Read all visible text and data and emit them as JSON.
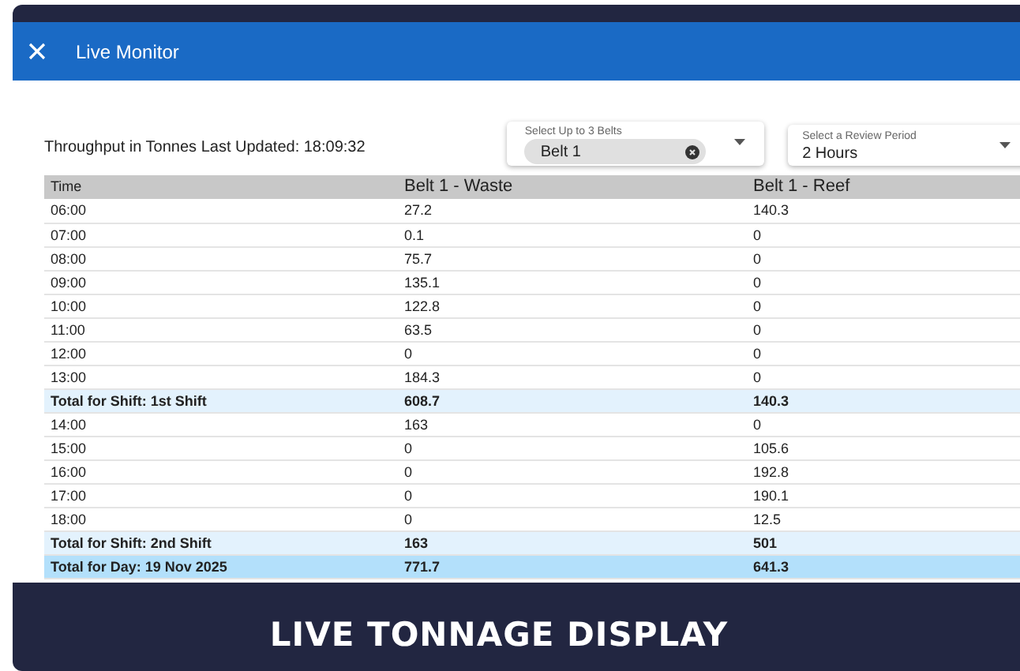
{
  "window": {
    "title": "Live Monitor"
  },
  "summary": "Throughput in Tonnes Last Updated: 18:09:32",
  "belt_select": {
    "label": "Select Up to 3 Belts",
    "chips": [
      "Belt 1"
    ]
  },
  "period_select": {
    "label": "Select a Review Period",
    "value": "2 Hours"
  },
  "table": {
    "columns": [
      "Time",
      "Belt 1 - Waste",
      "Belt 1 - Reef"
    ],
    "rows": [
      {
        "kind": "hour",
        "cells": [
          "06:00",
          "27.2",
          "140.3"
        ]
      },
      {
        "kind": "hour",
        "cells": [
          "07:00",
          "0.1",
          "0"
        ]
      },
      {
        "kind": "hour",
        "cells": [
          "08:00",
          "75.7",
          "0"
        ]
      },
      {
        "kind": "hour",
        "cells": [
          "09:00",
          "135.1",
          "0"
        ]
      },
      {
        "kind": "hour",
        "cells": [
          "10:00",
          "122.8",
          "0"
        ]
      },
      {
        "kind": "hour",
        "cells": [
          "11:00",
          "63.5",
          "0"
        ]
      },
      {
        "kind": "hour",
        "cells": [
          "12:00",
          "0",
          "0"
        ]
      },
      {
        "kind": "hour",
        "cells": [
          "13:00",
          "184.3",
          "0"
        ]
      },
      {
        "kind": "shift_total",
        "cells": [
          "Total for Shift: 1st Shift",
          "608.7",
          "140.3"
        ]
      },
      {
        "kind": "hour",
        "cells": [
          "14:00",
          "163",
          "0"
        ]
      },
      {
        "kind": "hour",
        "cells": [
          "15:00",
          "0",
          "105.6"
        ]
      },
      {
        "kind": "hour",
        "cells": [
          "16:00",
          "0",
          "192.8"
        ]
      },
      {
        "kind": "hour",
        "cells": [
          "17:00",
          "0",
          "190.1"
        ]
      },
      {
        "kind": "hour",
        "cells": [
          "18:00",
          "0",
          "12.5"
        ]
      },
      {
        "kind": "shift_total",
        "cells": [
          "Total for Shift: 2nd Shift",
          "163",
          "501"
        ]
      },
      {
        "kind": "day_total",
        "cells": [
          "Total for Day: 19 Nov 2025",
          "771.7",
          "641.3"
        ]
      }
    ]
  },
  "banner": "LIVE TONNAGE DISPLAY"
}
